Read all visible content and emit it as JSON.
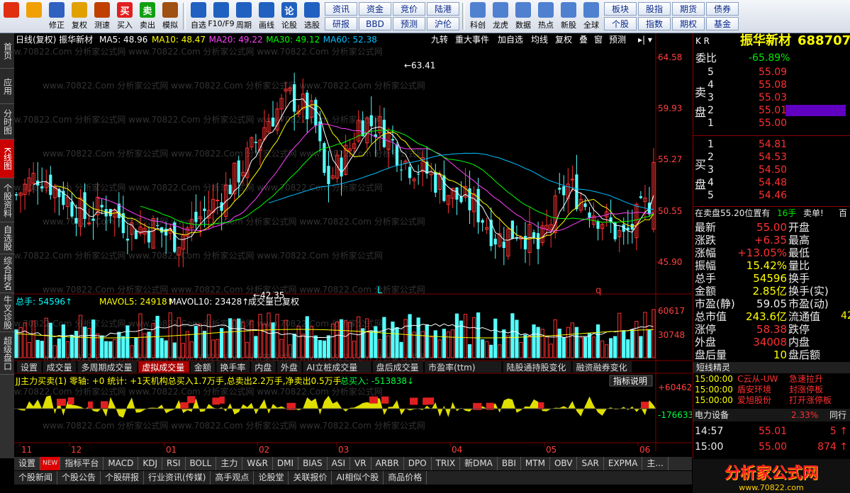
{
  "toolbar": {
    "buttons": [
      {
        "label": "",
        "icon": "windows-icon",
        "color": "#e03010"
      },
      {
        "label": "",
        "icon": "back-arrow-icon",
        "color": "#f0a000"
      },
      {
        "label": "修正",
        "icon": "home-icon",
        "color": "#3060c0"
      },
      {
        "label": "复权",
        "icon": "refresh-icon",
        "color": "#e0a000"
      },
      {
        "label": "测速",
        "icon": "clock-icon",
        "color": "#c04000"
      },
      {
        "label": "买入",
        "icon": "buy-icon",
        "color": "#e02020",
        "glyph": "买"
      },
      {
        "label": "卖出",
        "icon": "sell-icon",
        "color": "#10a010",
        "glyph": "卖"
      },
      {
        "label": "模拟",
        "icon": "hammer-icon",
        "color": "#a05010"
      },
      {
        "label": "自选",
        "icon": "star-icon",
        "color": "#2060c0"
      },
      {
        "label": "F10/F9",
        "icon": "f10-icon",
        "color": "#2060c0"
      },
      {
        "label": "周期",
        "icon": "period-icon",
        "color": "#2060c0"
      },
      {
        "label": "画线",
        "icon": "pencil-icon",
        "color": "#2060c0"
      },
      {
        "label": "论股",
        "icon": "discuss-icon",
        "color": "#2060c0",
        "glyph": "论"
      },
      {
        "label": "选股",
        "icon": "select-stock-icon",
        "color": "#2060c0"
      }
    ],
    "grid1": [
      "资讯",
      "研报",
      "资金",
      "BBD",
      "竞价",
      "预测",
      "陆港",
      "沪伦"
    ],
    "buttons2": [
      {
        "label": "科创",
        "icon": "chart-icon"
      },
      {
        "label": "龙虎",
        "icon": "dragon-icon"
      },
      {
        "label": "数据",
        "icon": "pe-icon"
      },
      {
        "label": "热点",
        "icon": "hot-icon"
      },
      {
        "label": "新股",
        "icon": "new-stock-icon"
      },
      {
        "label": "全球",
        "icon": "globe-icon"
      }
    ],
    "grid2": [
      "板块",
      "个股",
      "股指",
      "指数",
      "期货",
      "期权",
      "债券",
      "基金"
    ]
  },
  "left_tabs": [
    "首页",
    "应用",
    "分时图",
    "K线图",
    "个股资料",
    "自选股",
    "综合排名",
    "牛叉诊股",
    "超级盘口"
  ],
  "kline": {
    "title": "日线(复权) 振华新材",
    "ma": [
      {
        "label": "MA5: 48.96",
        "color": "#ffffff"
      },
      {
        "label": "MA10: 48.47",
        "color": "#ffff00"
      },
      {
        "label": "MA20: 49.22",
        "color": "#ff40ff"
      },
      {
        "label": "MA30: 49.12",
        "color": "#00ff00"
      },
      {
        "label": "MA60: 52.38",
        "color": "#00c0ff"
      }
    ],
    "top_menu": [
      "九转",
      "重大事件",
      "加自选",
      "均线",
      "复权",
      "叠",
      "窗",
      "预测"
    ],
    "price_ticks": [
      "64.58",
      "59.93",
      "55.27",
      "50.55",
      "45.90"
    ],
    "hi_label": "63.41",
    "lo_label": "42.35",
    "marker_L": "L",
    "marker_q": "q",
    "watermark": "www.70822.Com 分析家公式网"
  },
  "volume": {
    "label_total": "总手: 54596",
    "label_ma5": "MAVOL5: 24918",
    "label_ma10": "MAVOL10: 23428",
    "label_note": "成交量已复权",
    "ticks": [
      "60617",
      "30748"
    ]
  },
  "mid_tabs": [
    "设置",
    "成交量",
    "多周期成交量",
    "虚拟成交量",
    "金额",
    "换手率",
    "内盘",
    "外盘",
    "AI立桩成交量",
    "盘后成交量",
    "市盈率(ttm)",
    "陆股通持股变化",
    "融资融券变化"
  ],
  "indicator": {
    "title": "JJ主力买卖(1) 零轴: +0 统计: +1天机构总买入1.7万手,总卖出2.2万手,净卖出0.5万手",
    "total_buy": "总买入: -513838",
    "explain_btn": "指标说明",
    "ticks": [
      "+604620",
      "-176633"
    ]
  },
  "x_axis": [
    "11",
    "12",
    "01",
    "02",
    "03",
    "04",
    "05",
    "06"
  ],
  "bottom_tabs1": [
    "设置",
    "NEW",
    "指标平台",
    "MACD",
    "KDJ",
    "RSI",
    "BOLL",
    "主力",
    "W&R",
    "DMI",
    "BIAS",
    "ASI",
    "VR",
    "ARBR",
    "DPO",
    "TRIX",
    "新DMA",
    "BBI",
    "MTM",
    "OBV",
    "SAR",
    "EXPMA",
    "主..."
  ],
  "bottom_tabs2": [
    "个股新闻",
    "个股公告",
    "个股研报",
    "行业资讯(传媒)",
    "高手观点",
    "论股堂",
    "关联报价",
    "AI相似个股",
    "商品价格"
  ],
  "quote": {
    "header": "K R",
    "name": "振华新材",
    "code": "688707",
    "weibi_label": "委比",
    "weibi": "-65.89%",
    "sell_label": "卖盘",
    "buy_label": "买盘",
    "sells": [
      {
        "n": "5",
        "p": "55.09"
      },
      {
        "n": "4",
        "p": "55.08"
      },
      {
        "n": "3",
        "p": "55.03"
      },
      {
        "n": "2",
        "p": "55.01"
      },
      {
        "n": "1",
        "p": "55.00"
      }
    ],
    "buys": [
      {
        "n": "1",
        "p": "54.81"
      },
      {
        "n": "2",
        "p": "54.53"
      },
      {
        "n": "3",
        "p": "54.50"
      },
      {
        "n": "4",
        "p": "54.48"
      },
      {
        "n": "5",
        "p": "54.46"
      }
    ],
    "note_left": "在卖盘55.20位置有",
    "note_mid": "16手",
    "note_right": "卖单!",
    "note_extra": "百",
    "stats": [
      {
        "l": "最新",
        "v": "55.00",
        "vc": "red",
        "l2": "开盘"
      },
      {
        "l": "涨跌",
        "v": "+6.35",
        "vc": "red",
        "l2": "最高"
      },
      {
        "l": "涨幅",
        "v": "+13.05%",
        "vc": "red",
        "l2": "最低"
      },
      {
        "l": "振幅",
        "v": "15.42%",
        "vc": "yel",
        "l2": "量比"
      },
      {
        "l": "总手",
        "v": "54596",
        "vc": "yel",
        "l2": "换手"
      },
      {
        "l": "金额",
        "v": "2.85亿",
        "vc": "yel",
        "l2": "换手(实)"
      },
      {
        "l": "市盈(静)",
        "v": "59.05",
        "vc": "lbl",
        "l2": "市盈(动)"
      },
      {
        "l": "总市值",
        "v": "243.6亿",
        "vc": "yel",
        "l2": "流通值"
      },
      {
        "l": "涨停",
        "v": "58.38",
        "vc": "red",
        "l2": "跌停"
      },
      {
        "l": "外盘",
        "v": "34008",
        "vc": "red",
        "l2": "内盘"
      },
      {
        "l": "盘后量",
        "v": "10",
        "vc": "yel",
        "l2": "盘后额"
      }
    ],
    "stat_extra": "42",
    "elves_title": "短线精灵",
    "elves": [
      {
        "t": "15:00:00",
        "n": "C云从-UW",
        "e": "急速拉升"
      },
      {
        "t": "15:00:00",
        "n": "盾安环境",
        "e": "封涨停板"
      },
      {
        "t": "15:00:00",
        "n": "爱旭股份",
        "e": "打开涨停板"
      }
    ],
    "industry": "电力设备",
    "industry_pct": "2.33%",
    "industry_extra": "同行",
    "ticks": [
      {
        "t": "14:57",
        "p": "55.01",
        "v": "5"
      },
      {
        "t": "15:00",
        "p": "55.00",
        "v": "874"
      }
    ]
  },
  "logo_text": "分析家公式网",
  "logo_url": "www.70822.com",
  "colors": {
    "up": "#ff3030",
    "down": "#54ffff",
    "bg": "#000000",
    "grid": "#800000"
  }
}
